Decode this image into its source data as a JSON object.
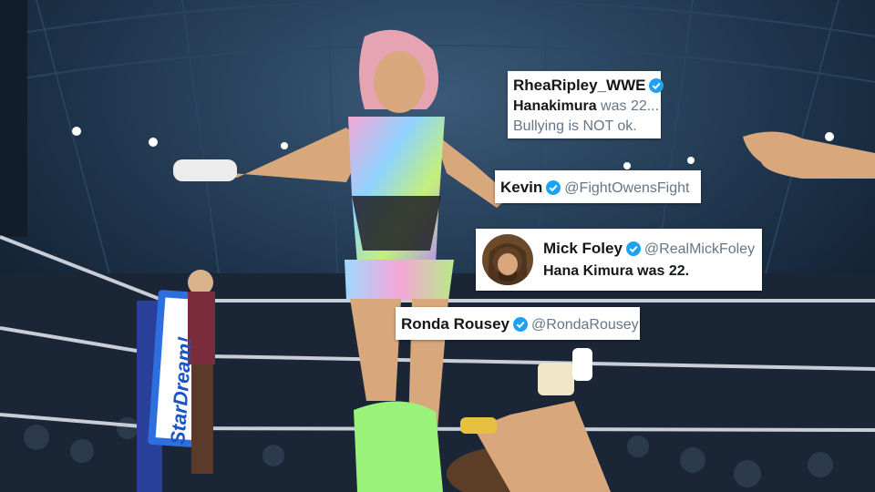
{
  "ring_sign": {
    "text": "StarDream!"
  },
  "tweets": [
    {
      "name": "RheaRipley_WWE",
      "verified": true,
      "lines": [
        {
          "bold": "Hanakimura",
          "rest": " was 22..."
        },
        {
          "bold": "",
          "rest": "Bullying is NOT ok."
        }
      ]
    },
    {
      "name": "Kevin",
      "verified": true,
      "handle": "@FightOwensFight"
    },
    {
      "name": "Mick Foley",
      "verified": true,
      "handle": "@RealMickFoley",
      "lines": [
        {
          "bold": "Hana Kimura",
          "rest": " was 22."
        }
      ]
    },
    {
      "name": "Ronda Rousey",
      "verified": true,
      "handle": "@RondaRousey"
    }
  ],
  "colors": {
    "verified_badge": "#1da1f2",
    "card_bg": "#ffffff",
    "handle_text": "#657786"
  }
}
